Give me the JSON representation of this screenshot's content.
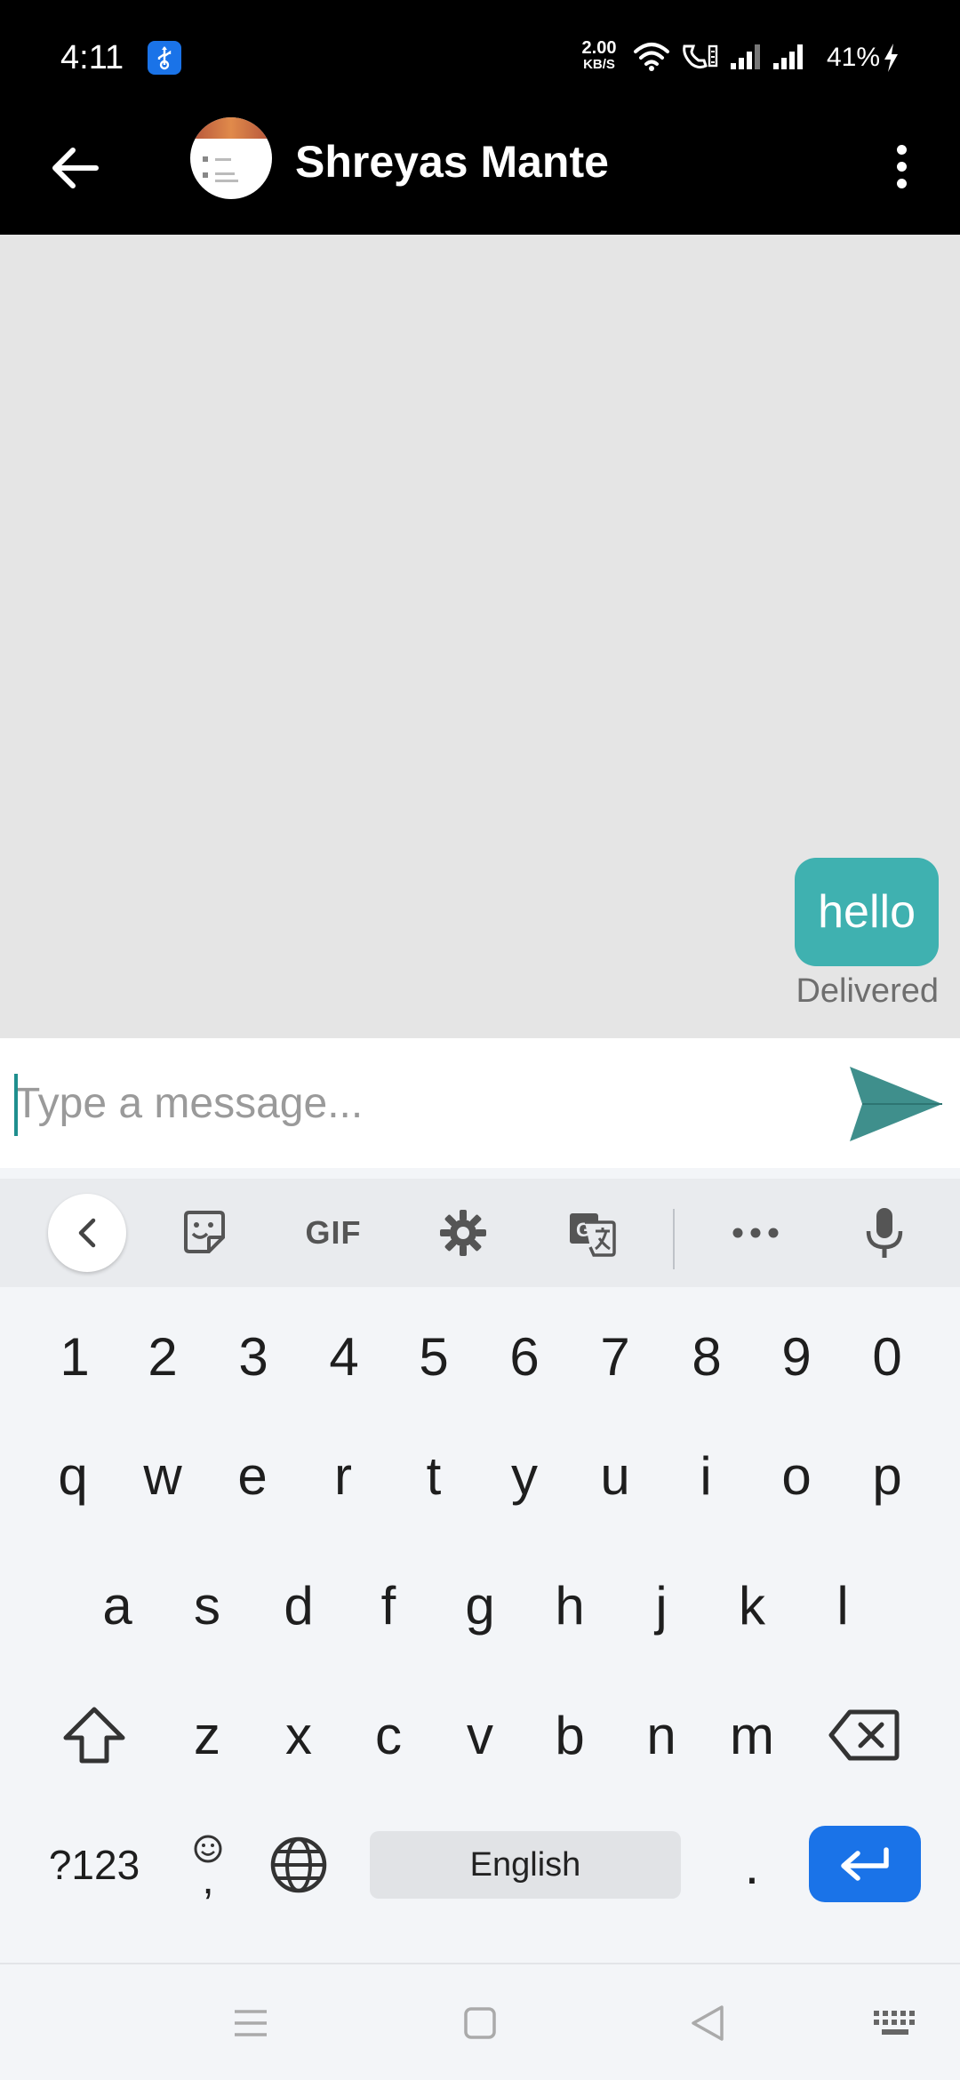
{
  "status_bar": {
    "time": "4:11",
    "net_speed": "2.00",
    "net_unit": "KB/S",
    "battery": "41%",
    "usb_icon": "usb-icon",
    "accent": "#1a73e8"
  },
  "header": {
    "contact_name": "Shreyas Mante",
    "background": "#000000"
  },
  "chat": {
    "messages": [
      {
        "text": "hello",
        "status": "Delivered",
        "from": "me",
        "bubble_color": "#3fb1b0"
      }
    ]
  },
  "composer": {
    "placeholder": "Type a message...",
    "value": ""
  },
  "keyboard": {
    "toolbar": {
      "gif_label": "GIF"
    },
    "rows": {
      "numbers": [
        "1",
        "2",
        "3",
        "4",
        "5",
        "6",
        "7",
        "8",
        "9",
        "0"
      ],
      "row1": [
        "q",
        "w",
        "e",
        "r",
        "t",
        "y",
        "u",
        "i",
        "o",
        "p"
      ],
      "row2": [
        "a",
        "s",
        "d",
        "f",
        "g",
        "h",
        "j",
        "k",
        "l"
      ],
      "row3": [
        "z",
        "x",
        "c",
        "v",
        "b",
        "n",
        "m"
      ]
    },
    "symbols_label": "?123",
    "comma_label": ",",
    "period_label": ".",
    "space_label": "English",
    "enter_color": "#1a73e8"
  }
}
